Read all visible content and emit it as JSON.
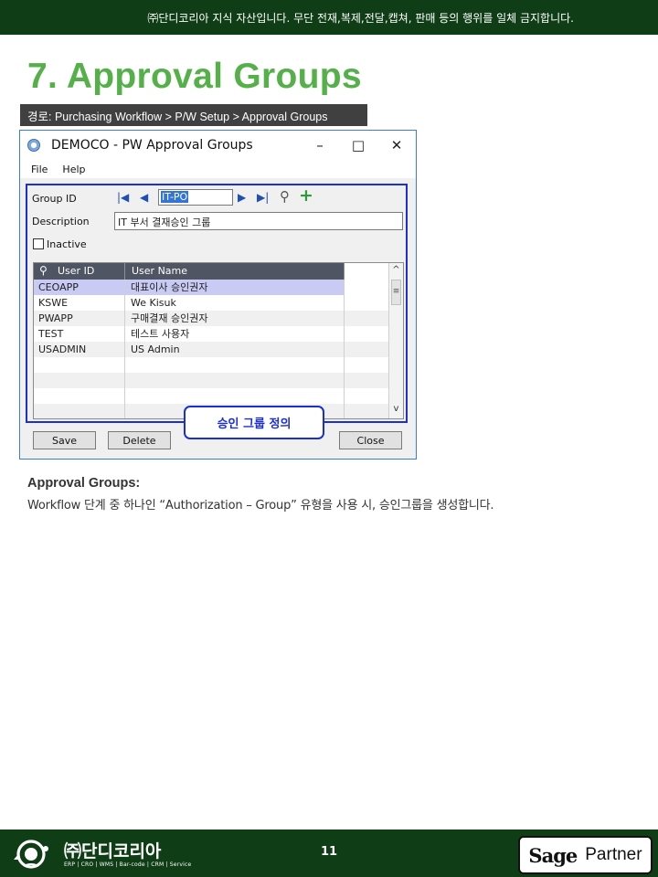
{
  "header": {
    "notice": "㈜단디코리아 지식 자산입니다. 무단 전재,복제,전달,캡쳐, 판매 등의 행위를 일체 금지합니다."
  },
  "page": {
    "title": "7. Approval Groups",
    "path": "경로: Purchasing Workflow > P/W Setup > Approval Groups"
  },
  "window": {
    "title": "DEMOCO - PW Approval Groups",
    "minimize": "–",
    "maximize": "□",
    "close": "✕",
    "menu": [
      "File",
      "Help"
    ],
    "form": {
      "group_id_label": "Group ID",
      "group_id_value": "IT-PO",
      "description_label": "Description",
      "description_value": "IT 부서 결재승인 그룹",
      "inactive_label": "Inactive",
      "nav": {
        "first": "|◀",
        "prev": "◀",
        "next": "▶",
        "last": "▶|",
        "search": "⚲",
        "add": "+"
      }
    },
    "grid": {
      "columns": [
        "User ID",
        "User Name"
      ],
      "rows": [
        [
          "CEOAPP",
          "대표이사 승인권자"
        ],
        [
          "KSWE",
          "We Kisuk"
        ],
        [
          "PWAPP",
          "구매결재 승인권자"
        ],
        [
          "TEST",
          "테스트 사용자"
        ],
        [
          "USADMIN",
          "US Admin"
        ],
        [
          "",
          ""
        ],
        [
          "",
          ""
        ],
        [
          "",
          ""
        ],
        [
          "",
          ""
        ]
      ],
      "scroll_up": "^",
      "scroll_down": "v",
      "scroll_thumb": "≡"
    },
    "buttons": {
      "save": "Save",
      "delete": "Delete",
      "close": "Close"
    },
    "callout": "승인 그룹 정의"
  },
  "content": {
    "heading": "Approval Groups:",
    "text": "Workflow 단계 중 하나인 “Authorization – Group” 유형을 사용 시, 승인그룹을 생성합니다."
  },
  "footer": {
    "company": "㈜단디코리아",
    "tagline": "ERP | CRO | WMS | Bar-code | CRM | Service",
    "page_number": "11",
    "partner_brand": "Sage",
    "partner_label": "Partner"
  },
  "colors": {
    "brand_green": "#55b04a",
    "dark_green": "#0f3d16",
    "highlight_blue": "#1a2fd6"
  }
}
